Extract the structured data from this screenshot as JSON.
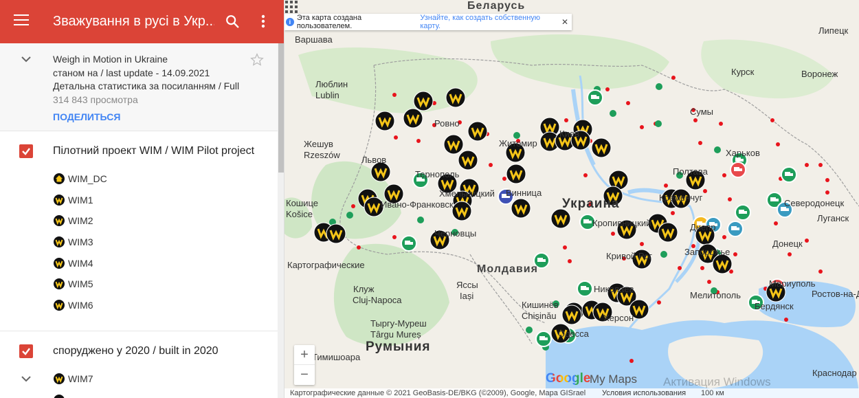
{
  "header": {
    "title": "Зважування в русі в Укр...",
    "menu_icon": "menu-icon",
    "search_icon": "search-icon",
    "more_icon": "more-vert-icon",
    "color": "#db4437"
  },
  "info": {
    "line1": "Weigh in Motion in Ukraine",
    "line2": "станом на / last update - 14.09.2021",
    "line3": "Детальна статистика за посиланням / Full",
    "views": "314 843 просмотра",
    "share": "ПОДЕЛИТЬСЯ"
  },
  "layers": [
    {
      "title": "Пілотний проект WIM / WIM Pilot project",
      "checked": true,
      "items": [
        "WIM_DC",
        "WIM1",
        "WIM2",
        "WIM3",
        "WIM4",
        "WIM5",
        "WIM6"
      ]
    },
    {
      "title": "споруджено у 2020 / built in 2020",
      "checked": true,
      "items": [
        "WIM7"
      ]
    }
  ],
  "map": {
    "notice_text": "Эта карта создана пользователем.",
    "notice_link": "Узнайте, как создать собственную карту.",
    "labels": [
      {
        "text": "Беларусь",
        "cls": "mid"
      },
      {
        "text": "Украина",
        "cls": "big"
      },
      {
        "text": "Молдавия",
        "cls": "mid"
      },
      {
        "text": "Румыния",
        "cls": "big"
      },
      {
        "text": "Варшава"
      },
      {
        "text": "Люблин"
      },
      {
        "text": "Lublin"
      },
      {
        "text": "Жешув"
      },
      {
        "text": "Rzeszów"
      },
      {
        "text": "Львов"
      },
      {
        "text": "Ровно"
      },
      {
        "text": "Житомир"
      },
      {
        "text": "Киев"
      },
      {
        "text": "Тернополь"
      },
      {
        "text": "Хмельницкий"
      },
      {
        "text": "Ивано-Франковск"
      },
      {
        "text": "Винница"
      },
      {
        "text": "Черновцы"
      },
      {
        "text": "Кошице"
      },
      {
        "text": "Košice"
      },
      {
        "text": "Картографические"
      },
      {
        "text": "Клуж"
      },
      {
        "text": "Cluj-Napoca"
      },
      {
        "text": "Яссы"
      },
      {
        "text": "Iași"
      },
      {
        "text": "Кишинёв"
      },
      {
        "text": "Chișinău"
      },
      {
        "text": "Тыргу-Муреш"
      },
      {
        "text": "Târgu Mureș"
      },
      {
        "text": "Тимишоара"
      },
      {
        "text": "Одесса"
      },
      {
        "text": "Николаев"
      },
      {
        "text": "Херсон"
      },
      {
        "text": "Кропивницкий"
      },
      {
        "text": "Кривой Рог"
      },
      {
        "text": "Кременчуг"
      },
      {
        "text": "Полтава"
      },
      {
        "text": "Сумы"
      },
      {
        "text": "Курск"
      },
      {
        "text": "Воронеж"
      },
      {
        "text": "Липецк"
      },
      {
        "text": "Харьков"
      },
      {
        "text": "Днепр"
      },
      {
        "text": "Запорожье"
      },
      {
        "text": "Северодонецк"
      },
      {
        "text": "Луганск"
      },
      {
        "text": "Донецк"
      },
      {
        "text": "Мелитополь"
      },
      {
        "text": "Мариуполь"
      },
      {
        "text": "Бердянск"
      },
      {
        "text": "Ростов-на-Дону"
      },
      {
        "text": "Краснодар"
      }
    ],
    "google": "Google",
    "mymaps": "My Maps",
    "watermark": "Активация Windows",
    "footer_data": "Картографические данные © 2021 GeoBasis-DE/BKG (©2009), Google, Mapa GISrael",
    "footer_terms": "Условия использования",
    "footer_scale": "100 км",
    "zoom_in": "+",
    "zoom_out": "−",
    "colors": {
      "land": "#f2efe8",
      "forest": "#cfe6c5",
      "water": "#aad3f7",
      "wim_marker": "#111111",
      "truck_green": "#1e9e5a",
      "truck_blue": "#3f51b5",
      "truck_red": "#e8484b",
      "truck_yellow": "#f5b921",
      "truck_teal": "#3a9bc1",
      "dot_red": "#e8141c",
      "dot_green": "#1e9e5a"
    }
  }
}
